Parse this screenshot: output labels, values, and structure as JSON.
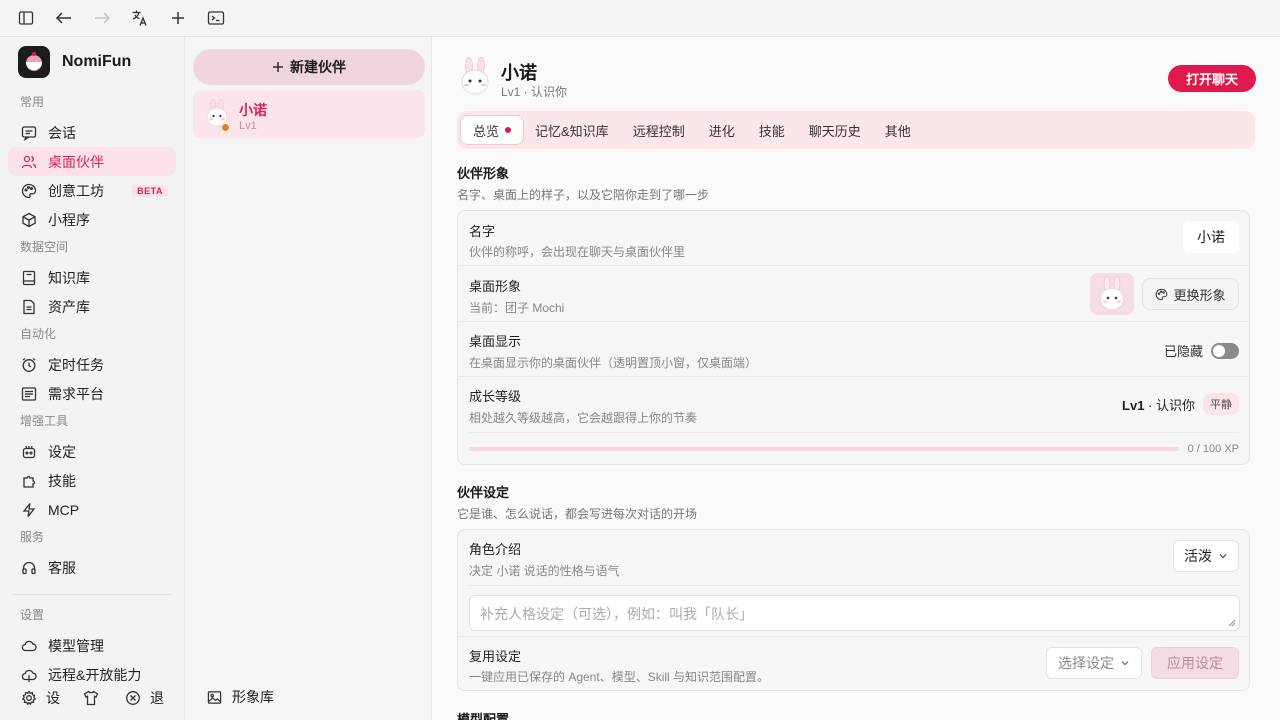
{
  "sidebar": {
    "brand": "NomiFun",
    "sections": {
      "common": "常用",
      "data": "数据空间",
      "automation": "自动化",
      "tools": "增强工具",
      "service": "服务",
      "settings": "设置"
    },
    "items": {
      "chat": "会话",
      "desktop_partner": "桌面伙伴",
      "creative": "创意工坊",
      "beta": "BETA",
      "miniapp": "小程序",
      "knowledge": "知识库",
      "assets": "资产库",
      "scheduled": "定时任务",
      "demand": "需求平台",
      "settings_item": "设定",
      "skills": "技能",
      "mcp": "MCP",
      "support": "客服",
      "models": "模型管理",
      "remote": "远程&开放能力"
    },
    "bottom": {
      "settings": "设",
      "exit": "退"
    }
  },
  "partner_list": {
    "new_button": "新建伙伴",
    "partners": [
      {
        "name": "小诺",
        "level": "Lv1"
      }
    ],
    "gallery": "形象库"
  },
  "header": {
    "name": "小诺",
    "subtitle": "Lv1 · 认识你",
    "open_chat": "打开聊天"
  },
  "tabs": [
    "总览",
    "记忆&知识库",
    "远程控制",
    "进化",
    "技能",
    "聊天历史",
    "其他"
  ],
  "appearance": {
    "title": "伙伴形象",
    "desc": "名字、桌面上的样子，以及它陪你走到了哪一步",
    "name_label": "名字",
    "name_desc": "伙伴的称呼，会出现在聊天与桌面伙伴里",
    "name_value": "小诺",
    "avatar_label": "桌面形象",
    "avatar_desc": "当前：团子 Mochi",
    "change_button": "更换形象",
    "display_label": "桌面显示",
    "display_desc": "在桌面显示你的桌面伙伴（透明置顶小窗，仅桌面端）",
    "display_state": "已隐藏",
    "growth_label": "成长等级",
    "growth_desc": "相处越久等级越高，它会越跟得上你的节奏",
    "level": "Lv1",
    "level_name": " · 认识你",
    "mood": "平静",
    "xp_text": "0 / 100 XP",
    "xp_fraction": 0
  },
  "persona": {
    "title": "伙伴设定",
    "desc": "它是谁、怎么说话，都会写进每次对话的开场",
    "role_label": "角色介绍",
    "role_desc": "决定 小诺 说话的性格与语气",
    "role_value": "活泼",
    "placeholder": "补充人格设定（可选），例如：叫我「队长」",
    "reuse_label": "复用设定",
    "reuse_desc": "一键应用已保存的 Agent、模型、Skill 与知识范围配置。",
    "reuse_select": "选择设定",
    "apply_button": "应用设定"
  },
  "model_title": "模型配置",
  "colors": {
    "accent": "#e0194d",
    "active_bg": "#fbe2e8"
  }
}
